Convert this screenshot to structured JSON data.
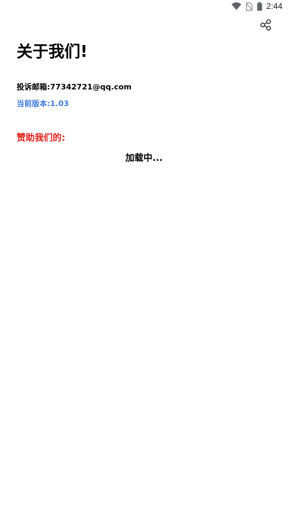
{
  "status_bar": {
    "time": "2:44",
    "icons": [
      "wifi-icon",
      "no-sim-icon",
      "battery-icon"
    ]
  },
  "toolbar": {
    "share_icon": "share-icon"
  },
  "page": {
    "title": "关于我们!",
    "complaint_email_label": "投诉邮箱:",
    "complaint_email": "77342721@qq.com",
    "version_label": "当前版本:",
    "version": "1.03",
    "sponsor_heading": "赞助我们的:",
    "loading_text": "加载中..."
  },
  "colors": {
    "version": "#3f7ad6",
    "sponsor_heading": "#e0201b",
    "background": "#ffffff"
  }
}
